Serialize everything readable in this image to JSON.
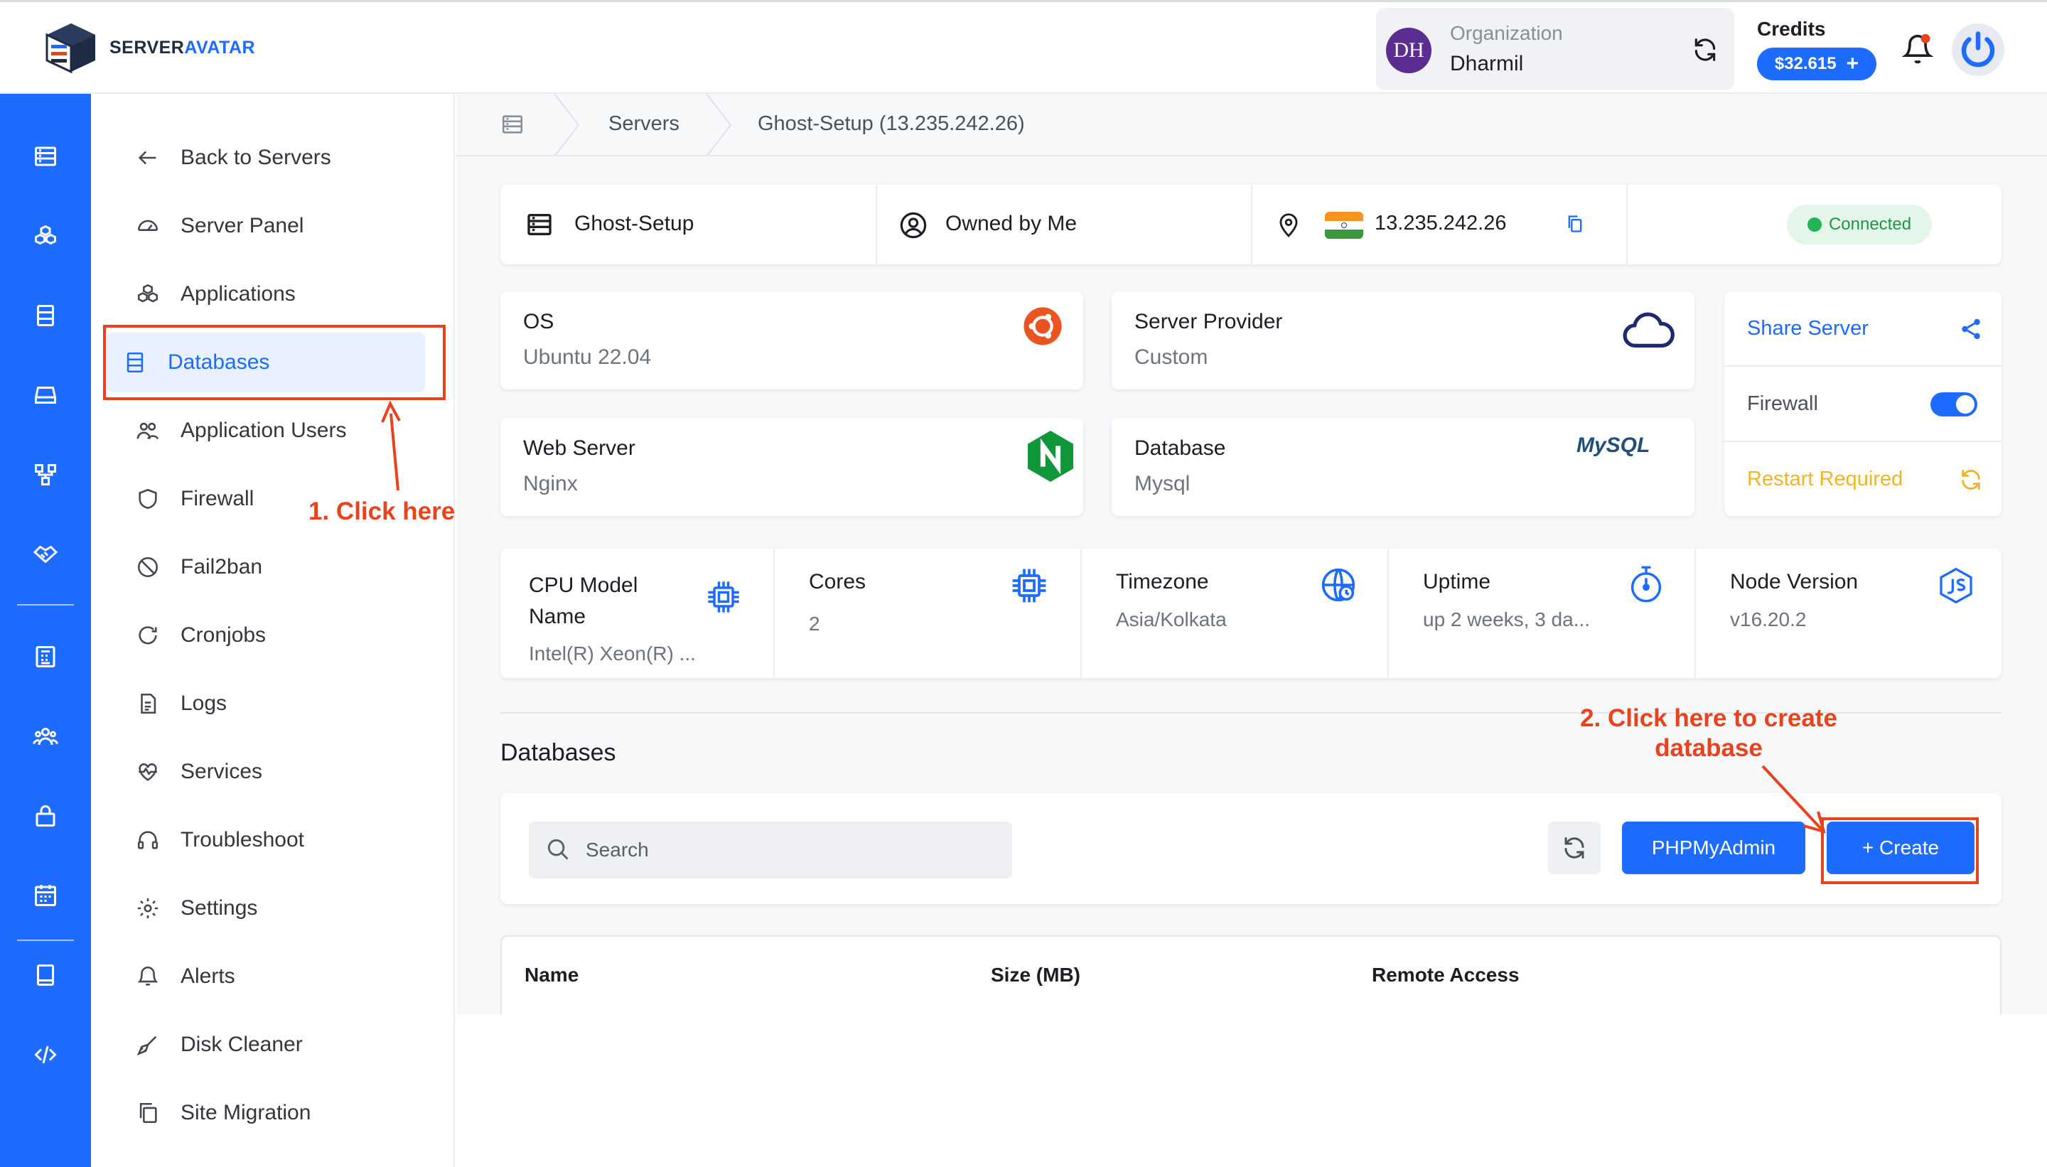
{
  "app": {
    "brand_left": "SERVER",
    "brand_right": "AVATAR"
  },
  "header": {
    "org_initials": "DH",
    "org_label": "Organization",
    "org_name": "Dharmil",
    "credits_label": "Credits",
    "credits_amount": "$32.615",
    "credits_add": "+"
  },
  "sidebar": {
    "items": [
      {
        "label": "Back to Servers",
        "icon": "arrow-left-icon"
      },
      {
        "label": "Server Panel",
        "icon": "gauge-icon"
      },
      {
        "label": "Applications",
        "icon": "cubes-icon"
      },
      {
        "label": "Databases",
        "icon": "database-icon",
        "active": true
      },
      {
        "label": "Application Users",
        "icon": "users-icon"
      },
      {
        "label": "Firewall",
        "icon": "shield-icon"
      },
      {
        "label": "Fail2ban",
        "icon": "ban-icon"
      },
      {
        "label": "Cronjobs",
        "icon": "refresh-icon"
      },
      {
        "label": "Logs",
        "icon": "document-icon"
      },
      {
        "label": "Services",
        "icon": "heartbeat-icon"
      },
      {
        "label": "Troubleshoot",
        "icon": "headset-icon"
      },
      {
        "label": "Settings",
        "icon": "gear-icon"
      },
      {
        "label": "Alerts",
        "icon": "bell-icon"
      },
      {
        "label": "Disk Cleaner",
        "icon": "broom-icon"
      },
      {
        "label": "Site Migration",
        "icon": "copy-icon"
      }
    ]
  },
  "breadcrumb": {
    "servers": "Servers",
    "current": "Ghost-Setup (13.235.242.26)"
  },
  "server_bar": {
    "name": "Ghost-Setup",
    "owner": "Owned by Me",
    "ip": "13.235.242.26",
    "status": "Connected"
  },
  "info": {
    "os_label": "OS",
    "os_value": "Ubuntu 22.04",
    "provider_label": "Server Provider",
    "provider_value": "Custom",
    "web_label": "Web Server",
    "web_value": "Nginx",
    "db_label": "Database",
    "db_value": "Mysql",
    "db_logo": "MySQL"
  },
  "actions": {
    "share": "Share Server",
    "firewall": "Firewall",
    "firewall_on": true,
    "restart": "Restart Required"
  },
  "stats": [
    {
      "label": "CPU Model Name",
      "value": "Intel(R) Xeon(R) ...",
      "icon": "chip-icon"
    },
    {
      "label": "Cores",
      "value": "2",
      "icon": "chip-icon"
    },
    {
      "label": "Timezone",
      "value": "Asia/Kolkata",
      "icon": "globe-icon"
    },
    {
      "label": "Uptime",
      "value": "up 2 weeks, 3 da...",
      "icon": "stopwatch-icon"
    },
    {
      "label": "Node Version",
      "value": "v16.20.2",
      "icon": "nodejs-icon"
    }
  ],
  "databases": {
    "title": "Databases",
    "search_placeholder": "Search",
    "phpmyadmin": "PHPMyAdmin",
    "create": "+ Create",
    "columns": [
      "Name",
      "Size (MB)",
      "Remote Access"
    ]
  },
  "annotations": {
    "step1": "1. Click here",
    "step2_line1": "2. Click here to create",
    "step2_line2": "database",
    "color": "#e8431f"
  },
  "colors": {
    "primary": "#1e6bff",
    "success": "#22b455",
    "warning": "#f0b428"
  }
}
